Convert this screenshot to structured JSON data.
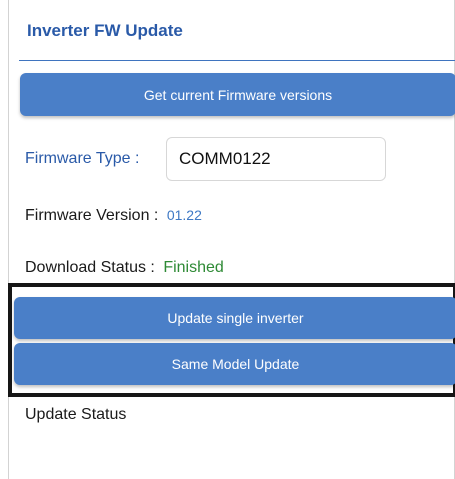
{
  "header": {
    "title": "Inverter FW Update"
  },
  "actions": {
    "get_versions_label": "Get current Firmware versions",
    "update_single_label": "Update single inverter",
    "same_model_label": "Same Model Update"
  },
  "firmware_type": {
    "label": "Firmware Type :",
    "value": "COMM0122"
  },
  "firmware_version": {
    "label": "Firmware Version :",
    "value": "01.22"
  },
  "download_status": {
    "label": "Download Status :",
    "value": "Finished"
  },
  "update_status": {
    "label": "Update Status"
  },
  "colors": {
    "accent_blue": "#4a7fc8",
    "header_text": "#2a5aa8",
    "success_green": "#2e8a35"
  }
}
